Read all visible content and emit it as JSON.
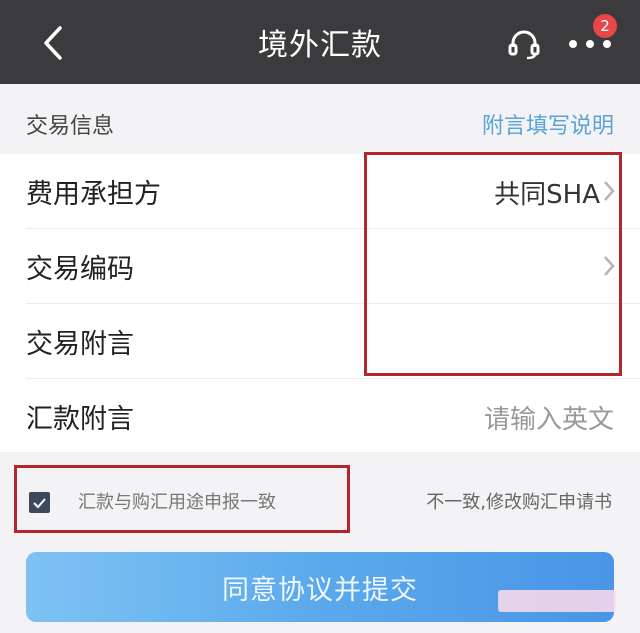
{
  "navbar": {
    "title": "境外汇款",
    "badge_count": "2",
    "icons": [
      "back-chevron-icon",
      "headset-icon",
      "more-dots-icon"
    ]
  },
  "section": {
    "title": "交易信息",
    "link": "附言填写说明"
  },
  "form": {
    "rows": [
      {
        "label": "费用承担方",
        "value": "共同SHA"
      },
      {
        "label": "交易编码",
        "value": ""
      },
      {
        "label": "交易附言",
        "value": ""
      },
      {
        "label": "汇款附言",
        "placeholder": "请输入英文"
      }
    ]
  },
  "agreement": {
    "checked": true,
    "text": "汇款与购汇用途申报一致",
    "link": "不一致,修改购汇申请书"
  },
  "submit": {
    "label": "同意协议并提交"
  },
  "colors": {
    "navbar": "#3b3b3d",
    "link": "#5aa3d8",
    "highlight_border": "#b3262b",
    "badge": "#e8474a",
    "button": "#5ba9ec"
  }
}
